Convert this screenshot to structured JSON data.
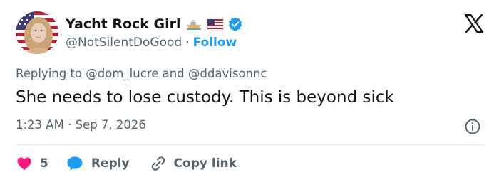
{
  "author": {
    "display_name": "Yacht Rock Girl",
    "handle": "@NotSilentDoGood",
    "separator": "·",
    "follow_label": "Follow",
    "verified": true,
    "emojis": [
      "boat-emoji",
      "us-flag-emoji"
    ]
  },
  "tweet": {
    "replying_prefix": "Replying to",
    "mention_1": "@dom_lucre",
    "conjunction": "and",
    "mention_2": "@ddavisonnc",
    "text": "She needs to lose custody. This is beyond sick",
    "time": "1:23 AM",
    "date_separator": "·",
    "date": "Sep 7, 2026"
  },
  "actions": {
    "like_count": "5",
    "reply_label": "Reply",
    "copy_link_label": "Copy link"
  },
  "colors": {
    "accent": "#1d9bf0",
    "text": "#0f1419",
    "secondary": "#536471",
    "like": "#f91880"
  }
}
